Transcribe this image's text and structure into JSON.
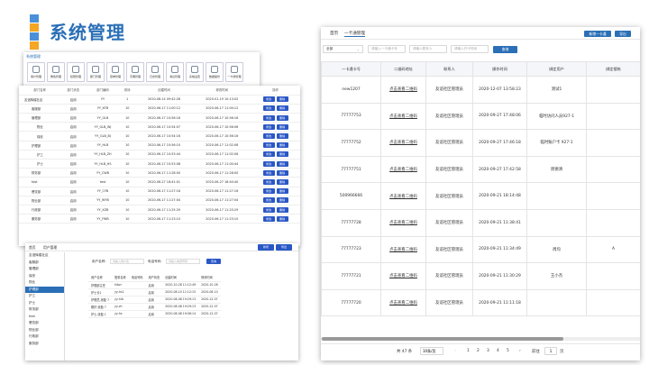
{
  "slide": {
    "title": "系统管理",
    "logo_colors": [
      "#4a90d9",
      "#f5a623",
      "#4a90d9",
      "#f5a623"
    ]
  },
  "win1": {
    "brand": "系统管理",
    "tools": [
      "用户管理",
      "角色管理",
      "权限管理",
      "部门管理",
      "菜单管理",
      "字典管理",
      "日志管理",
      "消息管理",
      "系统设置",
      "数据备份",
      "一卡通管理"
    ]
  },
  "win2": {
    "headers": [
      "部门名称",
      "部门状态",
      "部门编码",
      "排序",
      "创建时间",
      "修改时间",
      "操作"
    ],
    "rows": [
      [
        "友谊辉煌社区",
        "启用",
        "YY",
        "1",
        "2020-08-14 09:42:28",
        "2020-01-19 10:13:02"
      ],
      [
        "客服部",
        "启用",
        "YY_KFB",
        "10",
        "2020-06-17 11:00:12",
        "2020-06-17 11:00:12"
      ],
      [
        "管理部",
        "启用",
        "YY_GLB",
        "10",
        "2020-06-17 10:56:16",
        "2020-06-17 10:56:16"
      ],
      [
        "物业",
        "启用",
        "YY_GLB_WJ",
        "10",
        "2020-06-17 10:54:07",
        "2020-06-17 10:56:06"
      ],
      [
        "保安",
        "启用",
        "YY_GLB_BJ",
        "10",
        "2020-06-17 10:54:16",
        "2020-06-17 10:56:16"
      ],
      [
        "护理部",
        "启用",
        "YY_HLB",
        "10",
        "2020-06-17 10:56:10",
        "2020-06-17 11:02:06"
      ],
      [
        "护工",
        "启用",
        "YY_HLB_ZH",
        "10",
        "2020-06-17 10:53:44",
        "2020-06-17 11:02:06"
      ],
      [
        "护士",
        "启用",
        "YY_HLB_HS",
        "10",
        "2020-06-17 10:53:08",
        "2020-06-17 11:00:44"
      ],
      [
        "财务部",
        "启用",
        "YY_CWB",
        "10",
        "2020-06-17 11:28:00",
        "2020-06-17 11:28:00"
      ],
      [
        "test",
        "启用",
        "test",
        "10",
        "2020-06-27 18:41:01",
        "2020-06-27 18:40:40"
      ],
      [
        "餐饮部",
        "启用",
        "YY_CYB",
        "10",
        "2020-06-17 11:27:16",
        "2020-06-17 11:27:16"
      ],
      [
        "物业部",
        "启用",
        "YY_WYB",
        "10",
        "2020-06-17 11:27:04",
        "2020-06-17 11:27:04"
      ],
      [
        "行政部",
        "启用",
        "YY_XZB",
        "10",
        "2020-06-17 11:25:29",
        "2020-06-17 11:25:29"
      ],
      [
        "服务部",
        "启用",
        "YY_FWB",
        "10",
        "2020-06-17 11:23:10",
        "2020-06-17 11:23:10"
      ]
    ],
    "edit_label": "修改",
    "delete_label": "删除"
  },
  "win3": {
    "tabs": [
      "首页",
      "用户管理"
    ],
    "add_label": "新增",
    "export_label": "导出",
    "sidebar": [
      "友谊辉煌社区",
      "客服部",
      "管理部",
      "保安",
      "物业",
      "护理部",
      "护工",
      "护士",
      "财务部",
      "test",
      "餐饮部",
      "物业部",
      "行政部",
      "服务部"
    ],
    "filter_labels": [
      "用户名称:",
      "电话号码:"
    ],
    "filter_placeholders": [
      "请输入用户名",
      "请输入电话号码"
    ],
    "search_label": "查询",
    "headers": [
      "用户名称",
      "登录名称",
      "电话号码",
      "用户状态",
      "创建时间",
      "修改时间"
    ],
    "rows": [
      [
        "护理部主任",
        "hlbzr",
        "",
        "启用",
        "2020-10-28 11:12:49",
        "2020-10-28"
      ],
      [
        "护士长1",
        "yy-hs1",
        "",
        "启用",
        "2020-08-10 11:12:15",
        "2020-08-10"
      ],
      [
        "护理员,张磊 7",
        "yy-hlb",
        "",
        "启用",
        "2020-08-08 19:29:13",
        "2020-12-07"
      ],
      [
        "刚护,张磊 7",
        "yy-zh",
        "",
        "启用",
        "2020-08-08 19:29:13",
        "2020-12-07"
      ],
      [
        "护士,张磊 1",
        "yy-hs",
        "",
        "启用",
        "2020-08-08 19:08:14",
        "2020-12-07"
      ]
    ]
  },
  "main": {
    "tabs": [
      "首页",
      "一卡通管理"
    ],
    "new_card_label": "新增一卡通",
    "export_label": "导出",
    "filter_select": "全部",
    "filter_placeholders": [
      "请输入一卡通卡号",
      "请输入联系人",
      "请输入开卡时间"
    ],
    "search_label": "查询",
    "headers": [
      "一卡通卡号",
      "二维码地址",
      "联系人",
      "操作时间",
      "绑定用户",
      "绑定楼栋"
    ],
    "rows": [
      [
        "new1207",
        "点击查看二维码",
        "友谊社区管理员",
        "2020-12-07 13:58:23",
        "测试1",
        ""
      ],
      [
        "77777753",
        "点击查看二维码",
        "友谊社区管理员",
        "2020-09-27 17:48:06",
        "临时访问人员927-1",
        ""
      ],
      [
        "77777752",
        "点击查看二维码",
        "友谊社区管理员",
        "2020-09-27 17:46:18",
        "临时账户卡 927-1",
        ""
      ],
      [
        "77777751",
        "点击查看二维码",
        "友谊社区管理员",
        "2020-09-27 17:42:58",
        "周德清",
        ""
      ],
      [
        "500966666",
        "点击查看二维码",
        "友谊社区管理员",
        "2020-09-21 18:14:48",
        "",
        ""
      ],
      [
        "77777728",
        "点击查看二维码",
        "友谊社区管理员",
        "2020-09-21 11:38:41",
        "",
        ""
      ],
      [
        "77777723",
        "点击查看二维码",
        "友谊社区管理员",
        "2020-09-21 11:34:49",
        "周均",
        "A"
      ],
      [
        "77777721",
        "点击查看二维码",
        "友谊社区管理员",
        "2020-09-21 11:30:29",
        "王小杰",
        ""
      ],
      [
        "77777720",
        "点击查看二维码",
        "友谊社区管理员",
        "2020-09-21 11:11:18",
        "",
        ""
      ]
    ],
    "pager": {
      "total": "共 47 条",
      "page_size": "10条/页",
      "prev": "‹",
      "pages": [
        "1",
        "2",
        "3",
        "4",
        "5"
      ],
      "next": "›",
      "goto_label": "前往",
      "goto_value": "1",
      "page_unit": "页"
    }
  }
}
